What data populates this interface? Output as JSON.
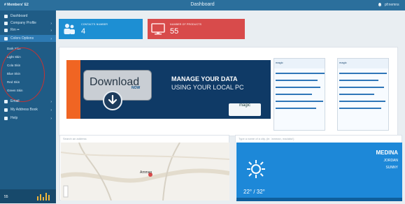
{
  "header": {
    "brand": "# Members' E2",
    "title": "Dashboard",
    "user": "pf:nemns"
  },
  "sidebar": {
    "items": [
      {
        "label": "Dashboard"
      },
      {
        "label": "Company Profile",
        "chevron": "›"
      },
      {
        "label": "Rm ••",
        "chevron": "›"
      },
      {
        "label": "Colors Options",
        "chevron": "›"
      },
      {
        "label": "Email",
        "chevron": "›"
      },
      {
        "label": "My Address Book",
        "chevron": "›"
      },
      {
        "label": "Help",
        "chevron": "›"
      }
    ],
    "color_skins": [
      "Dark Skin",
      "Light Skin",
      "Cola Skin",
      "Blue Skin",
      "Red Skin",
      "Green Skin"
    ],
    "stat_value": "55"
  },
  "tiles": [
    {
      "title": "CONTACTS NUMBER",
      "value": "4",
      "color": "#1d8fd3",
      "icon": "users-icon"
    },
    {
      "title": "NUMBER OF PRODUCTS",
      "value": "55",
      "color": "#d84b4b",
      "icon": "monitor-icon"
    }
  ],
  "banner": {
    "download": "Download",
    "now": "NOW",
    "headline": "MANAGE YOUR DATA",
    "subheadline": "USING YOUR LOCAL PC",
    "logo": "magic",
    "flyer_brand": "magic"
  },
  "map": {
    "placeholder": "Search an address",
    "city": "Amman"
  },
  "weather": {
    "placeholder": "Type a name of a city, (ie. 'amman, madaba')",
    "city": "MEDINA",
    "country": "JORDAN",
    "condition": "SUNNY",
    "temps": "22° / 32°"
  }
}
